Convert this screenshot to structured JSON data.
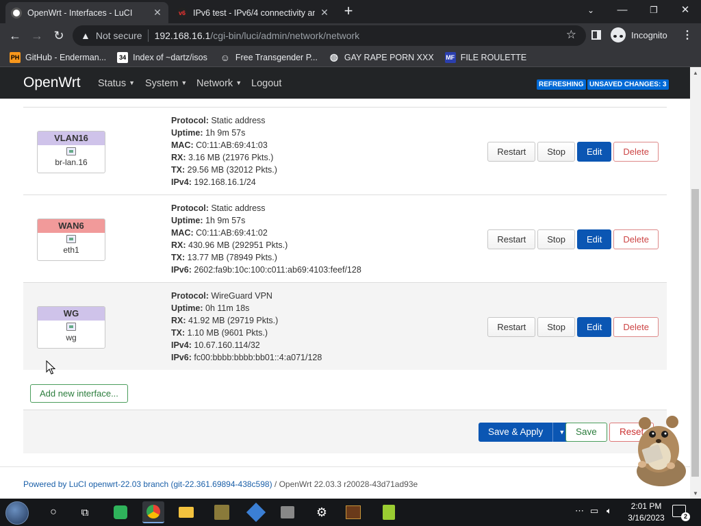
{
  "browser": {
    "tabs": [
      {
        "title": "OpenWrt - Interfaces - LuCI",
        "active": true
      },
      {
        "title": "IPv6 test - IPv6/4 connectivity an",
        "active": false
      }
    ],
    "omnibox": {
      "security_label": "Not secure",
      "url_host": "192.168.16.1",
      "url_path": "/cgi-bin/luci/admin/network/network"
    },
    "profile_label": "Incognito",
    "bookmarks": [
      {
        "label": "GitHub - Enderman...",
        "icon": "PH"
      },
      {
        "label": "Index of ~dartz/isos",
        "icon": "34"
      },
      {
        "label": "Free Transgender P...",
        "icon": "mask"
      },
      {
        "label": "GAY RAPE PORN XXX",
        "icon": "globe"
      },
      {
        "label": "FILE ROULETTE",
        "icon": "MF"
      }
    ]
  },
  "openwrt": {
    "brand": "OpenWrt",
    "nav": [
      "Status",
      "System",
      "Network",
      "Logout"
    ],
    "badges": {
      "refreshing": "REFRESHING",
      "unsaved": "UNSAVED CHANGES: 3"
    },
    "interfaces": [
      {
        "name": "VLAN16",
        "device": "br-lan.16",
        "color": "#cfc3ea",
        "info": [
          {
            "label": "Protocol:",
            "value": "Static address"
          },
          {
            "label": "Uptime:",
            "value": "1h 9m 57s"
          },
          {
            "label": "MAC:",
            "value": "C0:11:AB:69:41:03"
          },
          {
            "label": "RX:",
            "value": "3.16 MB (21976 Pkts.)"
          },
          {
            "label": "TX:",
            "value": "29.56 MB (32012 Pkts.)"
          },
          {
            "label": "IPv4:",
            "value": "192.168.16.1/24"
          }
        ]
      },
      {
        "name": "WAN6",
        "device": "eth1",
        "color": "#f19a9a",
        "info": [
          {
            "label": "Protocol:",
            "value": "Static address"
          },
          {
            "label": "Uptime:",
            "value": "1h 9m 57s"
          },
          {
            "label": "MAC:",
            "value": "C0:11:AB:69:41:02"
          },
          {
            "label": "RX:",
            "value": "430.96 MB (292951 Pkts.)"
          },
          {
            "label": "TX:",
            "value": "13.77 MB (78949 Pkts.)"
          },
          {
            "label": "IPv6:",
            "value": "2602:fa9b:10c:100:c011:ab69:4103:feef/128"
          }
        ]
      },
      {
        "name": "WG",
        "device": "wg",
        "color": "#cfc3ea",
        "info": [
          {
            "label": "Protocol:",
            "value": "WireGuard VPN"
          },
          {
            "label": "Uptime:",
            "value": "0h 11m 18s"
          },
          {
            "label": "RX:",
            "value": "41.92 MB (29719 Pkts.)"
          },
          {
            "label": "TX:",
            "value": "1.10 MB (9601 Pkts.)"
          },
          {
            "label": "IPv4:",
            "value": "10.67.160.114/32"
          },
          {
            "label": "IPv6:",
            "value": "fc00:bbbb:bbbb:bb01::4:a071/128"
          }
        ]
      }
    ],
    "row_buttons": {
      "restart": "Restart",
      "stop": "Stop",
      "edit": "Edit",
      "delete": "Delete"
    },
    "add_interface": "Add new interface...",
    "actions": {
      "save_apply": "Save & Apply",
      "save": "Save",
      "reset": "Reset"
    },
    "footer": {
      "powered": "Powered by LuCI openwrt-22.03 branch (git-22.361.69894-438c598)",
      "version": " / OpenWrt 22.03.3 r20028-43d71ad93e"
    }
  },
  "taskbar": {
    "time": "2:01 PM",
    "date": "3/16/2023",
    "notifications": "2"
  }
}
